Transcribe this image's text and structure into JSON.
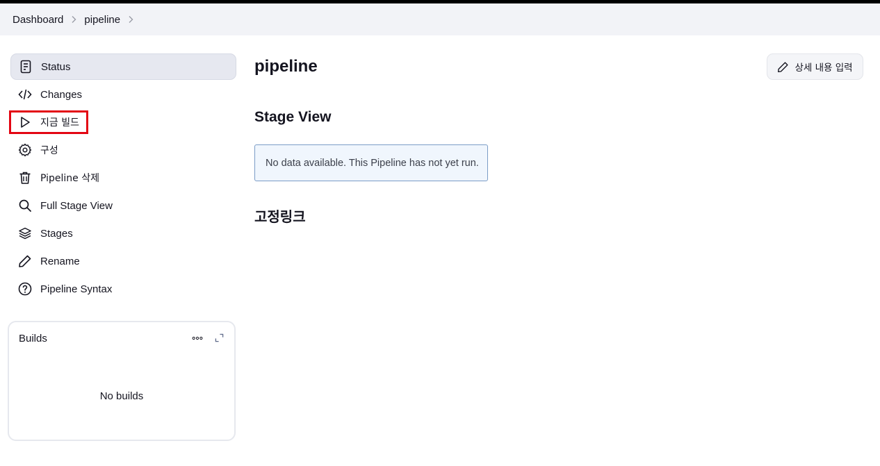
{
  "breadcrumb": {
    "items": [
      "Dashboard",
      "pipeline"
    ]
  },
  "sidebar": {
    "items": [
      {
        "label": "Status",
        "icon": "document-icon",
        "active": true
      },
      {
        "label": "Changes",
        "icon": "code-icon"
      },
      {
        "label": "지금 빌드",
        "icon": "play-icon",
        "highlighted": true
      },
      {
        "label": "구성",
        "icon": "gear-icon"
      },
      {
        "label": "Pipeline 삭제",
        "icon": "trash-icon"
      },
      {
        "label": "Full Stage View",
        "icon": "search-icon"
      },
      {
        "label": "Stages",
        "icon": "layers-icon"
      },
      {
        "label": "Rename",
        "icon": "pencil-icon"
      },
      {
        "label": "Pipeline Syntax",
        "icon": "help-circle-icon"
      }
    ]
  },
  "builds": {
    "title": "Builds",
    "empty_text": "No builds"
  },
  "main": {
    "title": "pipeline",
    "description_button": "상세 내용 입력",
    "stage_view_title": "Stage View",
    "stage_view_message": "No data available. This Pipeline has not yet run.",
    "permalinks_title": "고정링크"
  },
  "colors": {
    "highlight": "#e30613",
    "breadcrumb_bg": "#f2f3f7",
    "active_item_bg": "#e6e8f0",
    "info_bg": "#f0f6fd",
    "info_border": "#7a9cc6"
  }
}
